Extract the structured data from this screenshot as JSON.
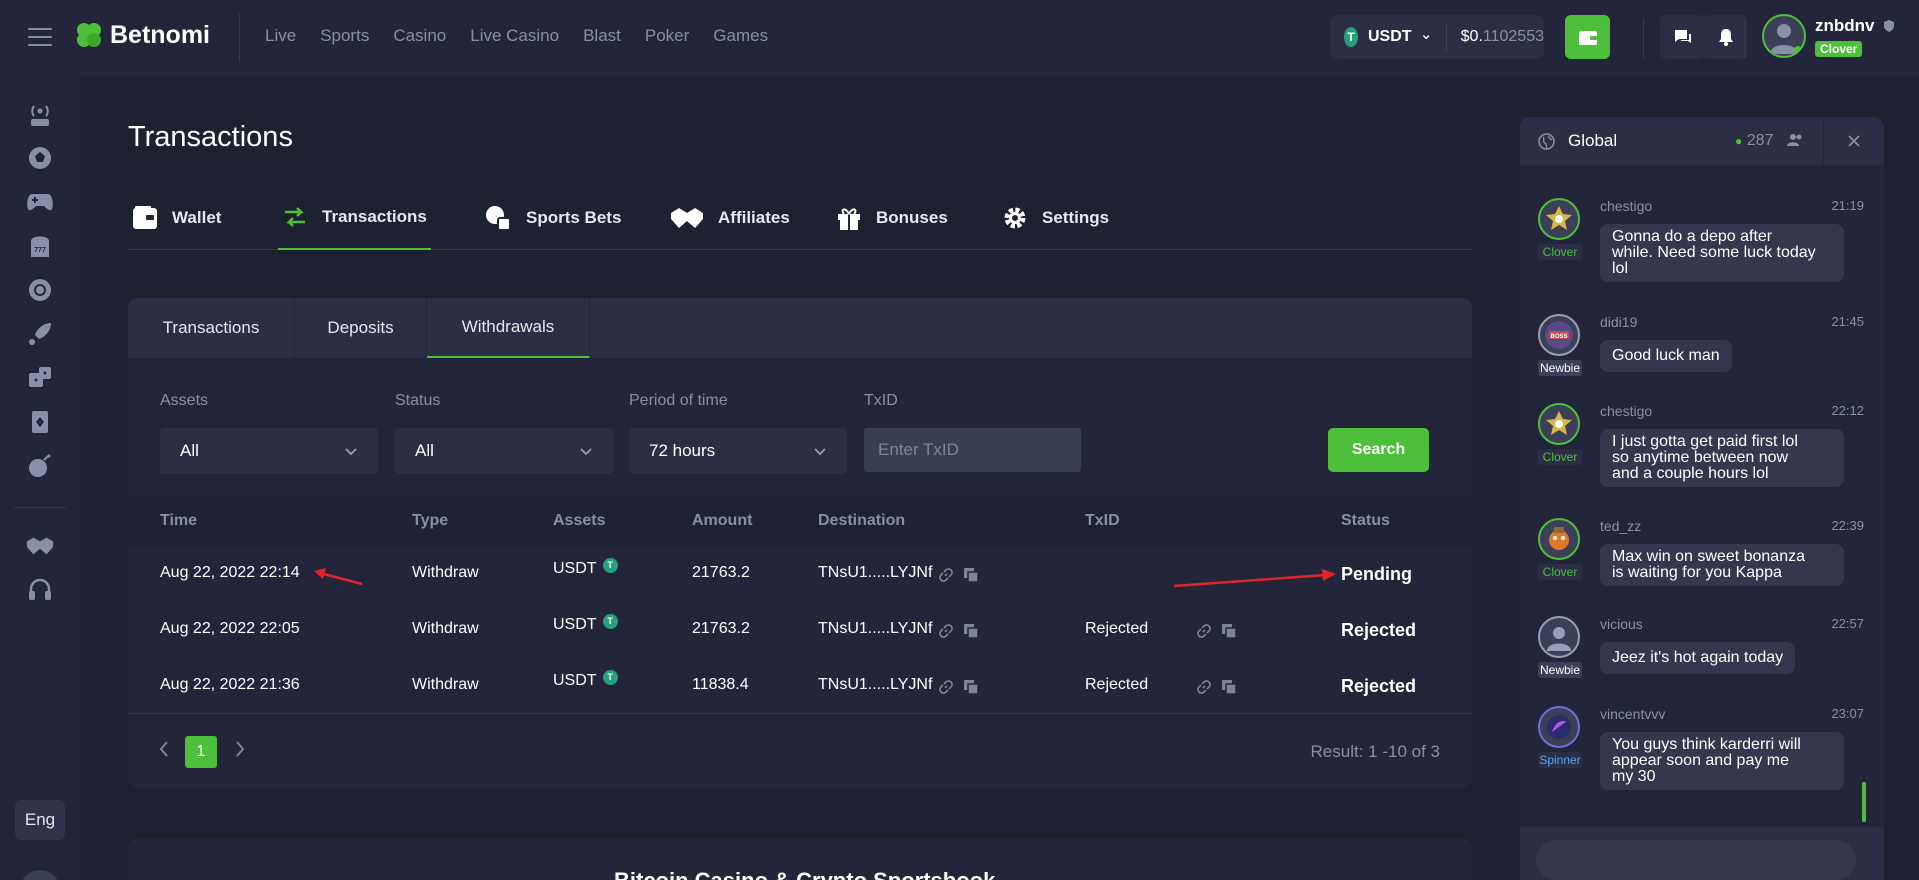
{
  "header": {
    "logo": "Betnomi",
    "nav": [
      "Live",
      "Sports",
      "Casino",
      "Live Casino",
      "Blast",
      "Poker",
      "Games"
    ],
    "currency": "USDT",
    "balance_main": "$0.",
    "balance_dim": "1102553",
    "username": "znbdnv",
    "user_badge": "Clover"
  },
  "sidebar": {
    "icons": [
      "live-icon",
      "sports-ball-icon",
      "gamepad-icon",
      "slot-777-icon",
      "casino-chip-icon",
      "rocket-icon",
      "dice-icon",
      "cards-icon",
      "bomb-icon",
      "handshake-icon",
      "headset-icon"
    ],
    "language": "Eng"
  },
  "page": {
    "title": "Transactions",
    "tabs": [
      "Wallet",
      "Transactions",
      "Sports Bets",
      "Affiliates",
      "Bonuses",
      "Settings"
    ],
    "active_tab": "Transactions"
  },
  "subtabs": [
    "Transactions",
    "Deposits",
    "Withdrawals"
  ],
  "filters": {
    "assets_label": "Assets",
    "assets_value": "All",
    "status_label": "Status",
    "status_value": "All",
    "period_label": "Period of time",
    "period_value": "72 hours",
    "txid_label": "TxID",
    "txid_placeholder": "Enter TxID",
    "search_label": "Search"
  },
  "table": {
    "columns": [
      "Time",
      "Type",
      "Assets",
      "Amount",
      "Destination",
      "TxID",
      "Status"
    ],
    "rows": [
      {
        "time": "Aug 22, 2022 22:14",
        "type": "Withdraw",
        "asset": "USDT",
        "amount": "21763.2",
        "destination": "TNsU1.....LYJNf",
        "txid": "",
        "status": "Pending"
      },
      {
        "time": "Aug 22, 2022 22:05",
        "type": "Withdraw",
        "asset": "USDT",
        "amount": "21763.2",
        "destination": "TNsU1.....LYJNf",
        "txid": "Rejected",
        "status": "Rejected"
      },
      {
        "time": "Aug 22, 2022 21:36",
        "type": "Withdraw",
        "asset": "USDT",
        "amount": "11838.4",
        "destination": "TNsU1.....LYJNf",
        "txid": "Rejected",
        "status": "Rejected"
      }
    ]
  },
  "pagination": {
    "current": "1",
    "result": "Result: 1 -10 of 3"
  },
  "footer": {
    "title": "Bitcoin Casino & Crypto Sportsbook"
  },
  "chat": {
    "title": "Global",
    "online": "287",
    "messages": [
      {
        "user": "chestigo",
        "time": "21:19",
        "badge": "Clover",
        "text": [
          "Gonna do a depo after",
          "while. Need some luck today",
          "lol"
        ]
      },
      {
        "user": "didi19",
        "time": "21:45",
        "badge": "Newbie",
        "text": [
          "Good luck man"
        ]
      },
      {
        "user": "chestigo",
        "time": "22:12",
        "badge": "Clover",
        "text": [
          "I just gotta get paid first lol",
          "so anytime between now",
          "and a couple hours lol"
        ]
      },
      {
        "user": "ted_zz",
        "time": "22:39",
        "badge": "Clover",
        "text": [
          "Max win on sweet bonanza",
          "is waiting for you Kappa"
        ]
      },
      {
        "user": "vicious",
        "time": "22:57",
        "badge": "Newbie",
        "text": [
          "Jeez it's hot again today"
        ]
      },
      {
        "user": "vincentvvv",
        "time": "23:07",
        "badge": "Spinner",
        "text": [
          "You guys think karderri will",
          "appear soon and pay me",
          "my 30"
        ]
      }
    ]
  },
  "colors": {
    "accent": "#4ebf3a",
    "background": "#1e2130",
    "panel": "#23263a",
    "usdt": "#26a17b",
    "annotation_arrow": "#e0262b"
  }
}
